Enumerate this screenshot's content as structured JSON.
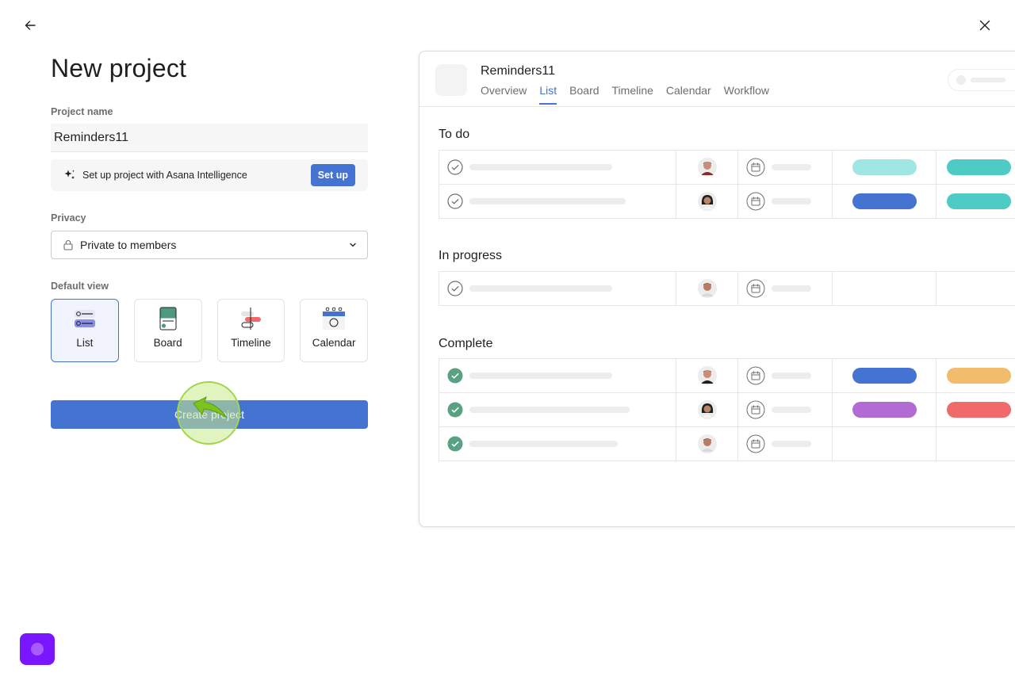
{
  "page": {
    "title": "New project"
  },
  "form": {
    "project_name_label": "Project name",
    "project_name_value": "Reminders11",
    "ai_text": "Set up project with Asana Intelligence",
    "ai_button": "Set up",
    "privacy_label": "Privacy",
    "privacy_value": "Private to members",
    "default_view_label": "Default view",
    "views": [
      {
        "label": "List",
        "selected": true
      },
      {
        "label": "Board",
        "selected": false
      },
      {
        "label": "Timeline",
        "selected": false
      },
      {
        "label": "Calendar",
        "selected": false
      }
    ],
    "create_button": "Create project"
  },
  "preview": {
    "project_title": "Reminders11",
    "tabs": [
      "Overview",
      "List",
      "Board",
      "Timeline",
      "Calendar",
      "Workflow"
    ],
    "active_tab": "List",
    "sections": [
      {
        "title": "To do"
      },
      {
        "title": "In progress"
      },
      {
        "title": "Complete"
      }
    ]
  },
  "colors": {
    "accent": "#4573d2",
    "complete_green": "#58a182",
    "tag_aqua_light": "#a0e6e2",
    "tag_aqua": "#4ecbc4",
    "tag_blue": "#4573d2",
    "tag_yellow": "#f1bd6c",
    "tag_purple": "#b36bd4",
    "tag_red": "#f06a6a",
    "launcher": "#7a16ff"
  },
  "icons": {
    "back": "arrow-left-icon",
    "close": "close-icon",
    "sparkle": "sparkle-icon",
    "lock": "lock-icon",
    "chevron": "chevron-down-icon",
    "check": "check-circle-icon",
    "calendar": "calendar-icon"
  }
}
